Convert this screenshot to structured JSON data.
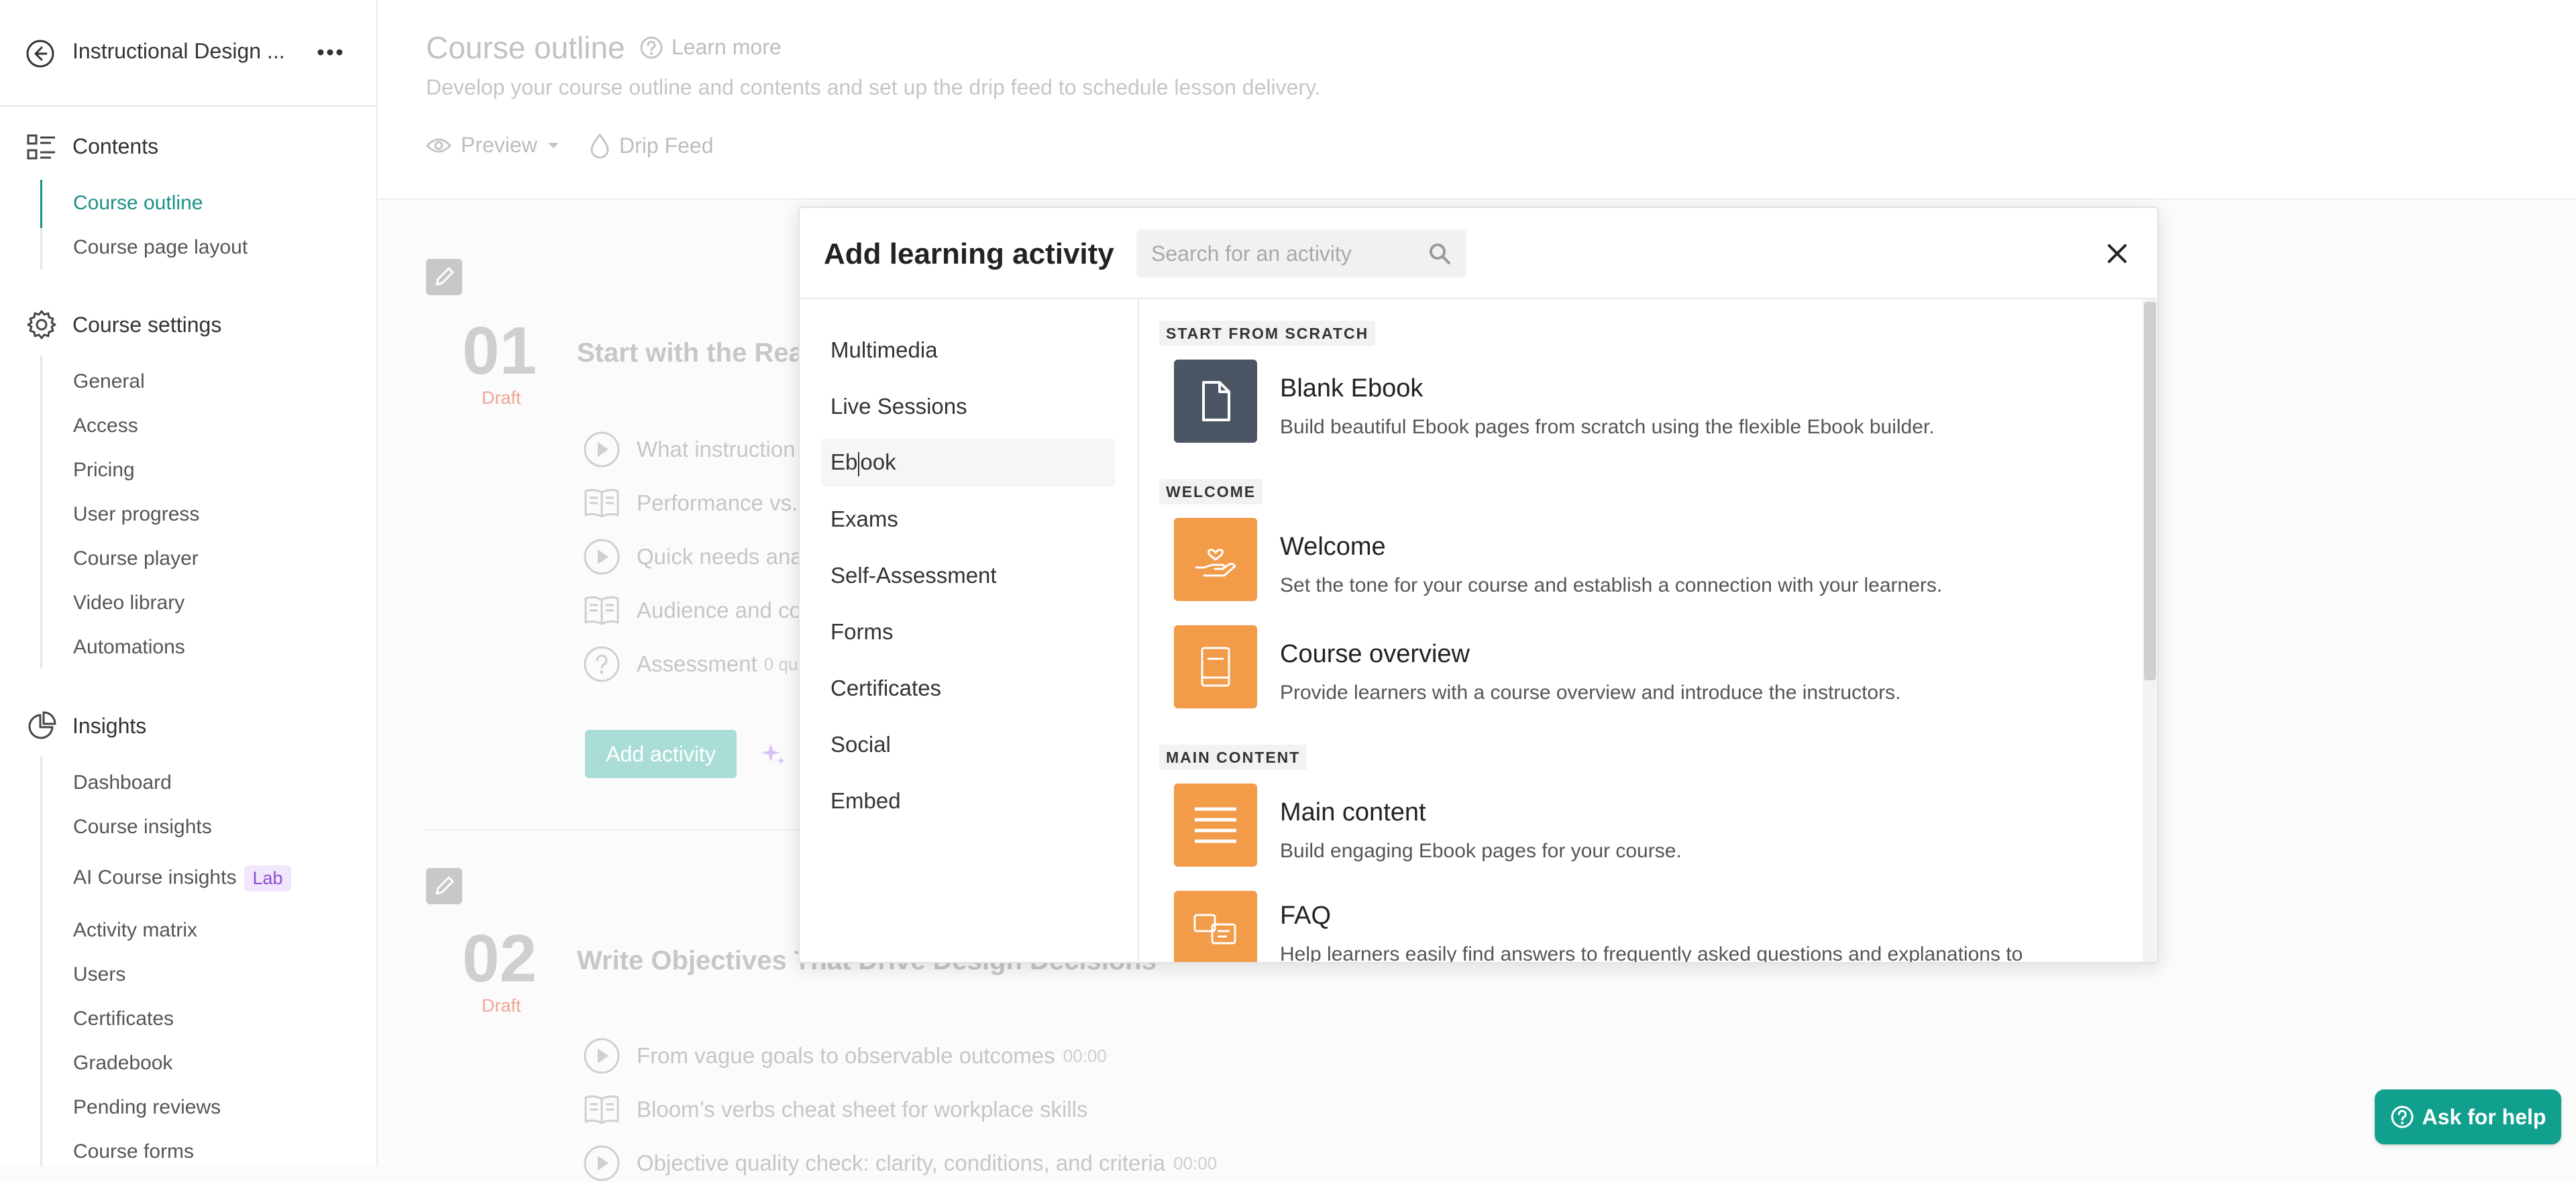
{
  "sidebar": {
    "course_title": "Instructional Design ...",
    "sections": [
      {
        "title": "Contents",
        "icon": "list-icon",
        "items": [
          "Course outline",
          "Course page layout"
        ],
        "active_index": 0
      },
      {
        "title": "Course settings",
        "icon": "gear-icon",
        "items": [
          "General",
          "Access",
          "Pricing",
          "User progress",
          "Course player",
          "Video library",
          "Automations"
        ]
      },
      {
        "title": "Insights",
        "icon": "pie-chart-icon",
        "items": [
          "Dashboard",
          "Course insights",
          "AI Course insights",
          "Activity matrix",
          "Users",
          "Certificates",
          "Gradebook",
          "Pending reviews",
          "Course forms"
        ]
      }
    ],
    "lab_badge": "Lab"
  },
  "header": {
    "title": "Course outline",
    "learn_more": "Learn more",
    "subtitle": "Develop your course outline and contents and set up the drip feed to schedule lesson delivery.",
    "preview_label": "Preview",
    "drip_feed_label": "Drip Feed"
  },
  "lessons": [
    {
      "number": "01",
      "status": "Draft",
      "title": "Start with the Rea",
      "activities": [
        {
          "icon": "play-icon",
          "label": "What instruction"
        },
        {
          "icon": "book-icon",
          "label": "Performance vs."
        },
        {
          "icon": "play-icon",
          "label": "Quick needs ana"
        },
        {
          "icon": "book-icon",
          "label": "Audience and co"
        },
        {
          "icon": "question-icon",
          "label": "Assessment",
          "extra": "0 qu"
        }
      ],
      "add_activity": "Add activity"
    },
    {
      "number": "02",
      "status": "Draft",
      "title": "Write Objectives That Drive Design Decisions",
      "activities": [
        {
          "icon": "play-icon",
          "label": "From vague goals to observable outcomes",
          "extra": "00:00"
        },
        {
          "icon": "book-icon",
          "label": "Bloom’s verbs cheat sheet for workplace skills"
        },
        {
          "icon": "play-icon",
          "label": "Objective quality check: clarity, conditions, and criteria",
          "extra": "00:00"
        }
      ]
    }
  ],
  "modal": {
    "title": "Add learning activity",
    "search_placeholder": "Search for an activity",
    "categories": [
      "Multimedia",
      "Live Sessions",
      "Ebook",
      "Exams",
      "Self-Assessment",
      "Forms",
      "Certificates",
      "Social",
      "Embed"
    ],
    "selected_category": "Ebook",
    "sections": [
      {
        "label": "START FROM SCRATCH",
        "options": [
          {
            "icon": "document-icon",
            "color": "#4b5563",
            "title": "Blank Ebook",
            "description": "Build beautiful Ebook pages from scratch using the flexible Ebook builder."
          }
        ]
      },
      {
        "label": "WELCOME",
        "options": [
          {
            "icon": "hand-heart-icon",
            "color": "#f29b48",
            "title": "Welcome",
            "description": "Set the tone for your course and establish a connection with your learners."
          },
          {
            "icon": "book-icon",
            "color": "#f29b48",
            "title": "Course overview",
            "description": "Provide learners with a course overview and introduce the instructors."
          }
        ]
      },
      {
        "label": "MAIN CONTENT",
        "options": [
          {
            "icon": "lines-icon",
            "color": "#f29b48",
            "title": "Main content",
            "description": "Build engaging Ebook pages for your course."
          },
          {
            "icon": "faq-icon",
            "color": "#f29b48",
            "title": "FAQ",
            "description": "Help learners easily find answers to frequently asked questions and explanations to"
          }
        ]
      }
    ]
  },
  "help_button": "Ask for help",
  "colors": {
    "accent": "#1b9086",
    "orange": "#f29b48",
    "slate": "#4b5563",
    "help": "#12a08e"
  }
}
